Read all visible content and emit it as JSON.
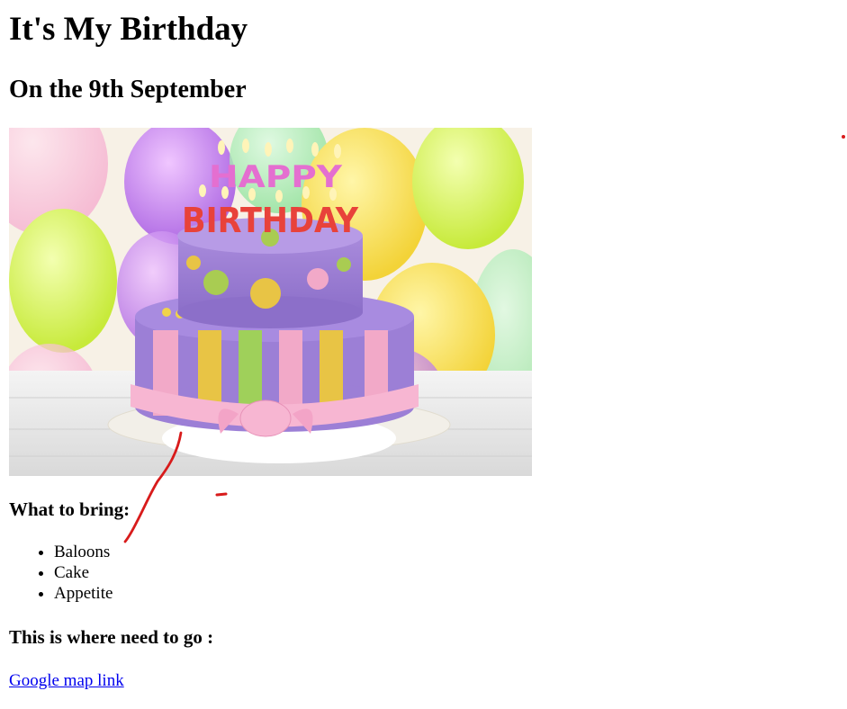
{
  "page": {
    "title": "It's My Birthday",
    "subtitle": "On the 9th September",
    "image_text": {
      "line1": "HAPPY",
      "line2": "BIRTHDAY"
    },
    "bring_heading": "What to bring:",
    "bring_items": [
      "Baloons",
      "Cake",
      "Appetite"
    ],
    "where_heading": "This is where need to go :",
    "map_link_label": "Google map link"
  },
  "colors": {
    "link": "#0000ee",
    "annotation": "#d81b1b"
  }
}
